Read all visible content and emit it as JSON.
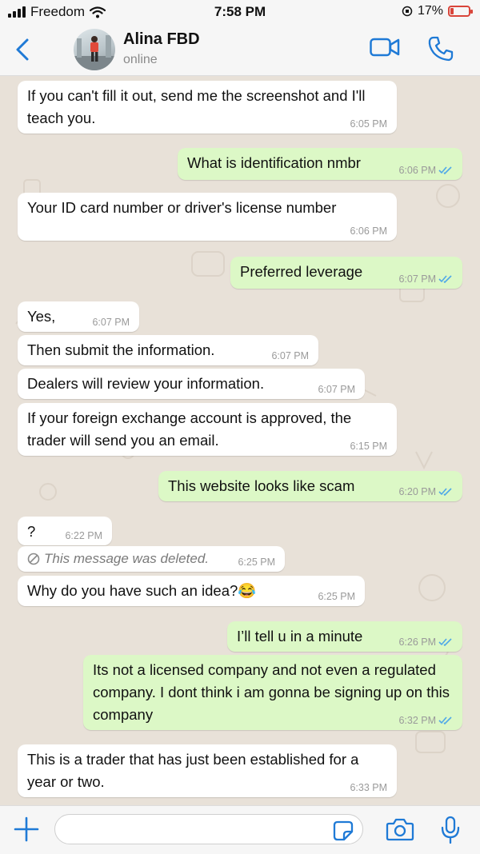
{
  "status_bar": {
    "carrier": "Freedom",
    "time": "7:58 PM",
    "battery_percent_label": "17%",
    "battery_level": 0.17
  },
  "header": {
    "contact_name": "Alina FBD",
    "contact_status": "online"
  },
  "messages": [
    {
      "dir": "in",
      "text": "If you can't fill it out, send me the screenshot and I'll teach you.",
      "time": "6:05 PM"
    },
    {
      "dir": "out",
      "text": "What is identification nmbr",
      "time": "6:06 PM",
      "read": true
    },
    {
      "dir": "in",
      "text": "Your ID card number or driver's license number",
      "time": "6:06 PM"
    },
    {
      "dir": "out",
      "text": "Preferred leverage",
      "time": "6:07 PM",
      "read": true
    },
    {
      "dir": "in",
      "text": "Yes,",
      "time": "6:07 PM"
    },
    {
      "dir": "in",
      "text": "Then submit the information.",
      "time": "6:07 PM"
    },
    {
      "dir": "in",
      "text": "Dealers will review your information.",
      "time": "6:07 PM"
    },
    {
      "dir": "in",
      "text": "If your foreign exchange account is approved, the trader will send you an email.",
      "time": "6:15 PM"
    },
    {
      "dir": "out",
      "text": "This website looks like scam",
      "time": "6:20 PM",
      "read": true
    },
    {
      "dir": "in",
      "text": "?",
      "time": "6:22 PM"
    },
    {
      "dir": "in",
      "deleted": true,
      "text": "This message was deleted.",
      "time": "6:25 PM"
    },
    {
      "dir": "in",
      "text": "Why do you have such an idea?😂",
      "time": "6:25 PM"
    },
    {
      "dir": "out",
      "text": "I’ll tell u in a minute",
      "time": "6:26 PM",
      "read": true
    },
    {
      "dir": "out",
      "text": "Its not a licensed company and not even a regulated company. I dont think i am gonna be signing up on this company",
      "time": "6:32 PM",
      "read": true
    },
    {
      "dir": "in",
      "text": "This is a trader that has just been established for a year or two.",
      "time": "6:33 PM"
    }
  ],
  "icons": {
    "back": "chevron-left-icon",
    "video": "video-camera-icon",
    "call": "phone-icon",
    "add": "plus-icon",
    "sticker": "sticker-icon",
    "camera": "camera-icon",
    "mic": "microphone-icon"
  },
  "colors": {
    "accent": "#1f7ad6",
    "incoming_bubble": "#ffffff",
    "outgoing_bubble": "#dcf8c6",
    "read_ticks": "#4fa8e8",
    "battery_low": "#d9453a",
    "chat_wallpaper": "#e8e1d8"
  }
}
